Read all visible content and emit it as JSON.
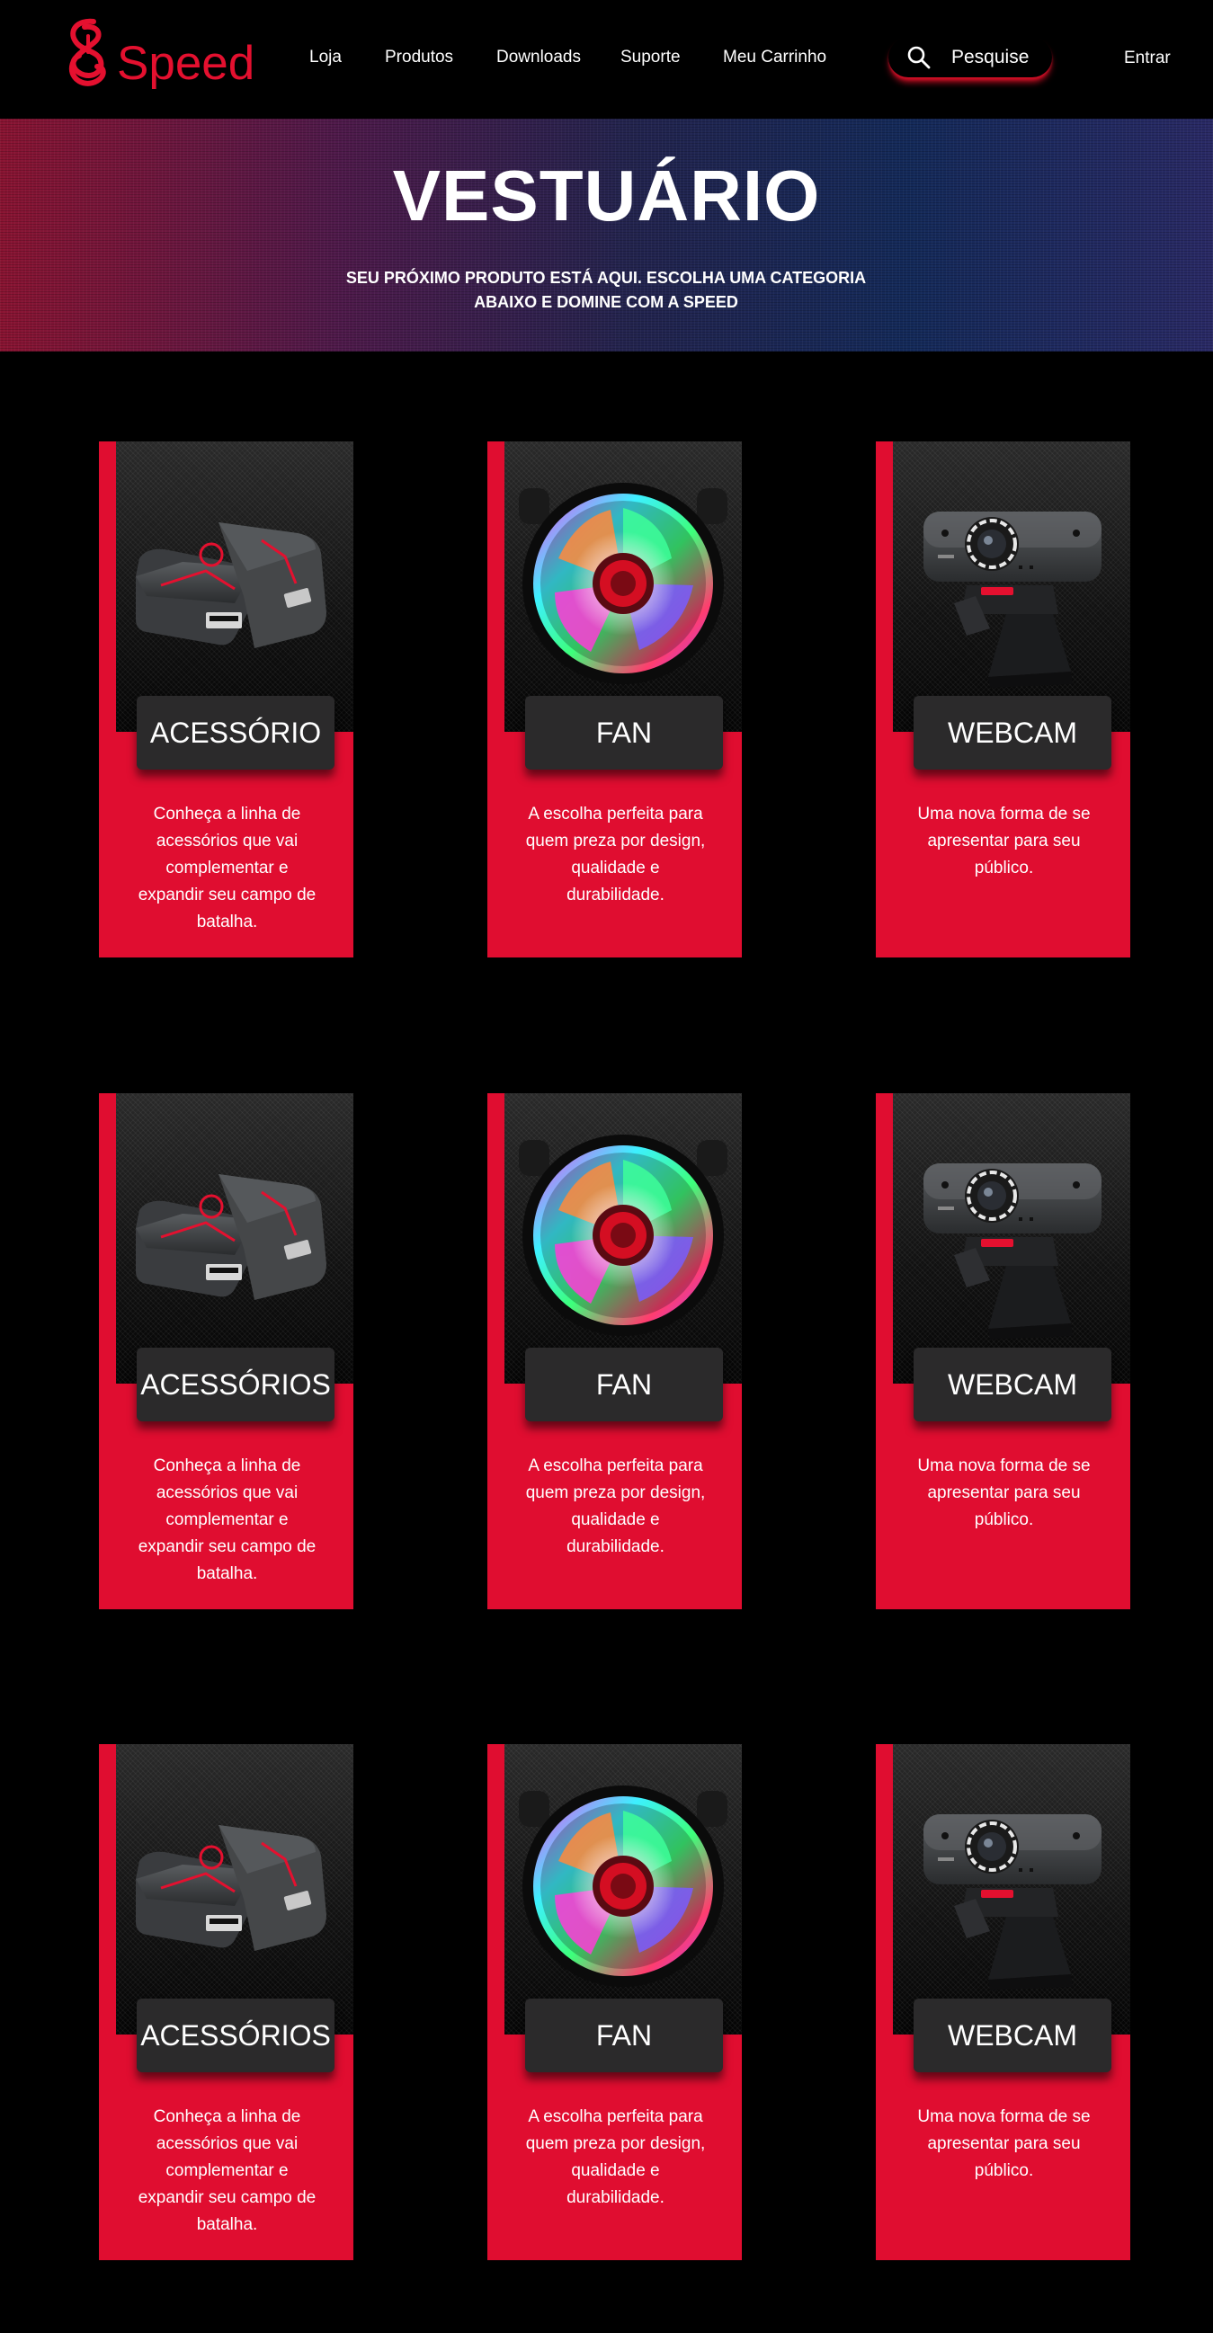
{
  "nav": {
    "logo_text": "Speed",
    "links": [
      "Loja",
      "Produtos",
      "Downloads",
      "Suporte",
      "Meu Carrinho"
    ],
    "search_placeholder": "Pesquise",
    "login": "Entrar"
  },
  "hero": {
    "title": "VESTUÁRIO",
    "subtitle": "SEU PRÓXIMO PRODUTO ESTÁ AQUI. ESCOLHA UMA CATEGORIA ABAIXO E DOMINE COM A SPEED"
  },
  "rows": [
    {
      "cards": [
        {
          "title": "ACESSÓRIO",
          "image": "usb-adapter",
          "description": "Conheça a linha de acessórios que vai complementar e expandir seu campo de batalha."
        },
        {
          "title": "FAN",
          "image": "rgb-fan",
          "description": "A escolha perfeita para quem preza por design, qualidade e durabilidade."
        },
        {
          "title": "WEBCAM",
          "image": "webcam",
          "description": "Uma nova forma de se apresentar para seu público."
        }
      ]
    },
    {
      "cards": [
        {
          "title": "ACESSÓRIOS",
          "image": "usb-adapter",
          "description": "Conheça a linha de acessórios que vai complementar e expandir seu campo de batalha."
        },
        {
          "title": "FAN",
          "image": "rgb-fan",
          "description": "A escolha perfeita para quem preza por design, qualidade e durabilidade."
        },
        {
          "title": "WEBCAM",
          "image": "webcam",
          "description": "Uma nova forma de se apresentar para seu público."
        }
      ]
    },
    {
      "cards": [
        {
          "title": "ACESSÓRIOS",
          "image": "usb-adapter",
          "description": "Conheça a linha de acessórios que vai complementar e expandir seu campo de batalha."
        },
        {
          "title": "FAN",
          "image": "rgb-fan",
          "description": "A escolha perfeita para quem preza por design, qualidade e durabilidade."
        },
        {
          "title": "WEBCAM",
          "image": "webcam",
          "description": "Uma nova forma de se apresentar para seu público."
        }
      ]
    }
  ],
  "colors": {
    "brand_red": "#e00d30",
    "card_title_bg": "#2b2a2b",
    "background": "#000000"
  }
}
